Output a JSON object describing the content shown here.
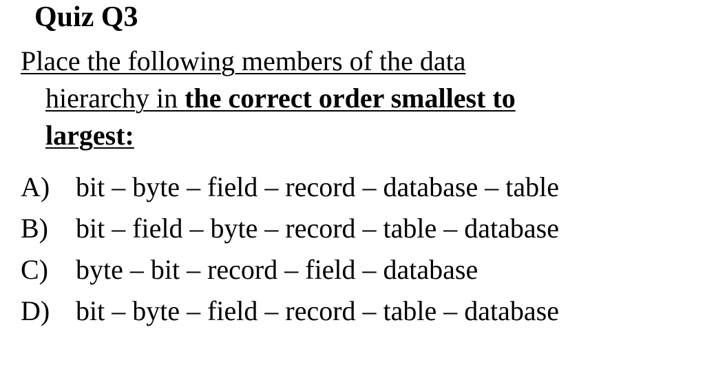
{
  "heading": "Quiz Q3",
  "prompt": {
    "line1": "Place the following members of the data",
    "line2_pre": "hierarchy in ",
    "line2_bold": "the correct order smallest to",
    "line3_bold": "largest:"
  },
  "options": [
    {
      "label": "A)",
      "text": "bit – byte – field – record – database – table"
    },
    {
      "label": "B)",
      "text": "bit – field – byte – record – table – database"
    },
    {
      "label": "C)",
      "text": "byte – bit – record – field – database"
    },
    {
      "label": "D)",
      "text": "bit – byte – field – record – table – database"
    }
  ]
}
